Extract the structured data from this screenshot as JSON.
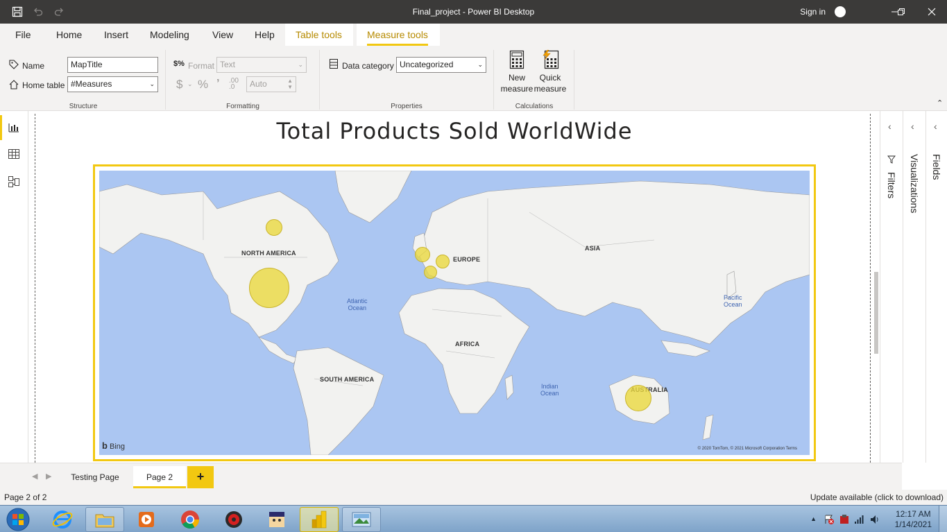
{
  "window": {
    "title": "Final_project - Power BI Desktop",
    "sign_in": "Sign in"
  },
  "ribbon_tabs": [
    "File",
    "Home",
    "Insert",
    "Modeling",
    "View",
    "Help",
    "Table tools",
    "Measure tools"
  ],
  "ribbon": {
    "structure": {
      "name_label": "Name",
      "name_value": "MapTitle",
      "home_table_label": "Home table",
      "home_table_value": "#Measures",
      "group": "Structure"
    },
    "formatting": {
      "format_label": "Format",
      "format_value": "Text",
      "currency": "$",
      "percent": "%",
      "comma": "\t",
      "decimals": "Auto",
      "group": "Formatting"
    },
    "properties": {
      "data_category_label": "Data category",
      "data_category_value": "Uncategorized",
      "group": "Properties"
    },
    "calculations": {
      "new_measure_line1": "New",
      "new_measure_line2": "measure",
      "quick_measure_line1": "Quick",
      "quick_measure_line2": "measure",
      "group": "Calculations"
    }
  },
  "report": {
    "title": "Total Products Sold WorldWide",
    "map": {
      "continents": [
        "NORTH AMERICA",
        "EUROPE",
        "ASIA",
        "AFRICA",
        "SOUTH AMERICA",
        "AUSTRALIA"
      ],
      "oceans": [
        [
          "Atlantic",
          "Ocean"
        ],
        [
          "Pacific",
          "Ocean"
        ],
        [
          "Indian",
          "Ocean"
        ]
      ],
      "provider": "Bing",
      "copyright": "© 2020 TomTom, © 2021 Microsoft Corporation  Terms"
    }
  },
  "panes": {
    "filters": "Filters",
    "visualizations": "Visualizations",
    "fields": "Fields"
  },
  "page_tabs": [
    "Testing Page",
    "Page 2"
  ],
  "add_page": "+",
  "status": {
    "page_indicator": "Page 2 of 2",
    "update": "Update available (click to download)"
  },
  "taskbar": {
    "time": "12:17 AM",
    "date": "1/14/2021"
  },
  "colors": {
    "accent": "#f2c811",
    "titlebar": "#3b3a39",
    "ocean": "#abc6f2",
    "land": "#f2f2f0",
    "bubble": "#ead840"
  }
}
